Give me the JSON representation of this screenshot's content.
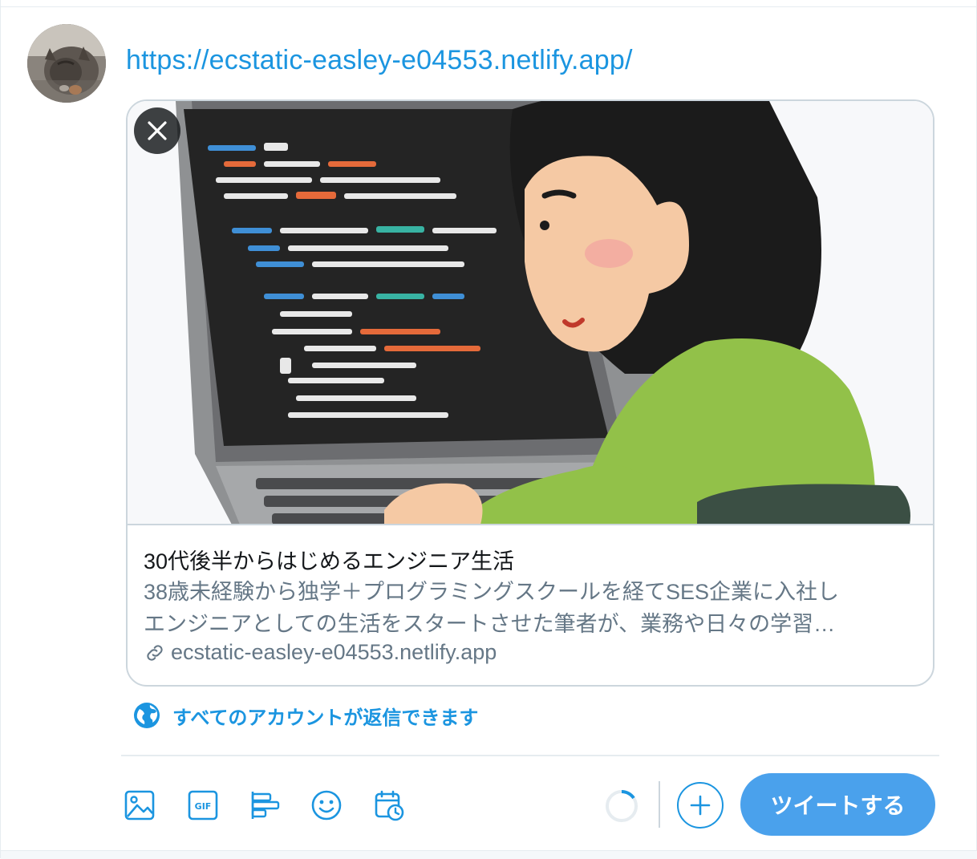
{
  "composer": {
    "text": "https://ecstatic-easley-e04553.netlify.app/"
  },
  "card": {
    "title": "30代後半からはじめるエンジニア生活",
    "description_line1": "38歳未経験から独学＋プログラミングスクールを経てSES企業に入社し",
    "description_line2": "エンジニアとしての生活をスタートさせた筆者が、業務や日々の学習…",
    "domain": "ecstatic-easley-e04553.netlify.app"
  },
  "reply_setting": {
    "label": "すべてのアカウントが返信できます"
  },
  "toolbar": {
    "icons": [
      "image-icon",
      "gif-icon",
      "poll-icon",
      "emoji-icon",
      "schedule-icon"
    ],
    "gif_label": "GIF",
    "tweet_button": "ツイートする"
  },
  "colors": {
    "accent": "#1b95e0",
    "button": "#4aa1ec",
    "border": "#ccd6dd"
  }
}
